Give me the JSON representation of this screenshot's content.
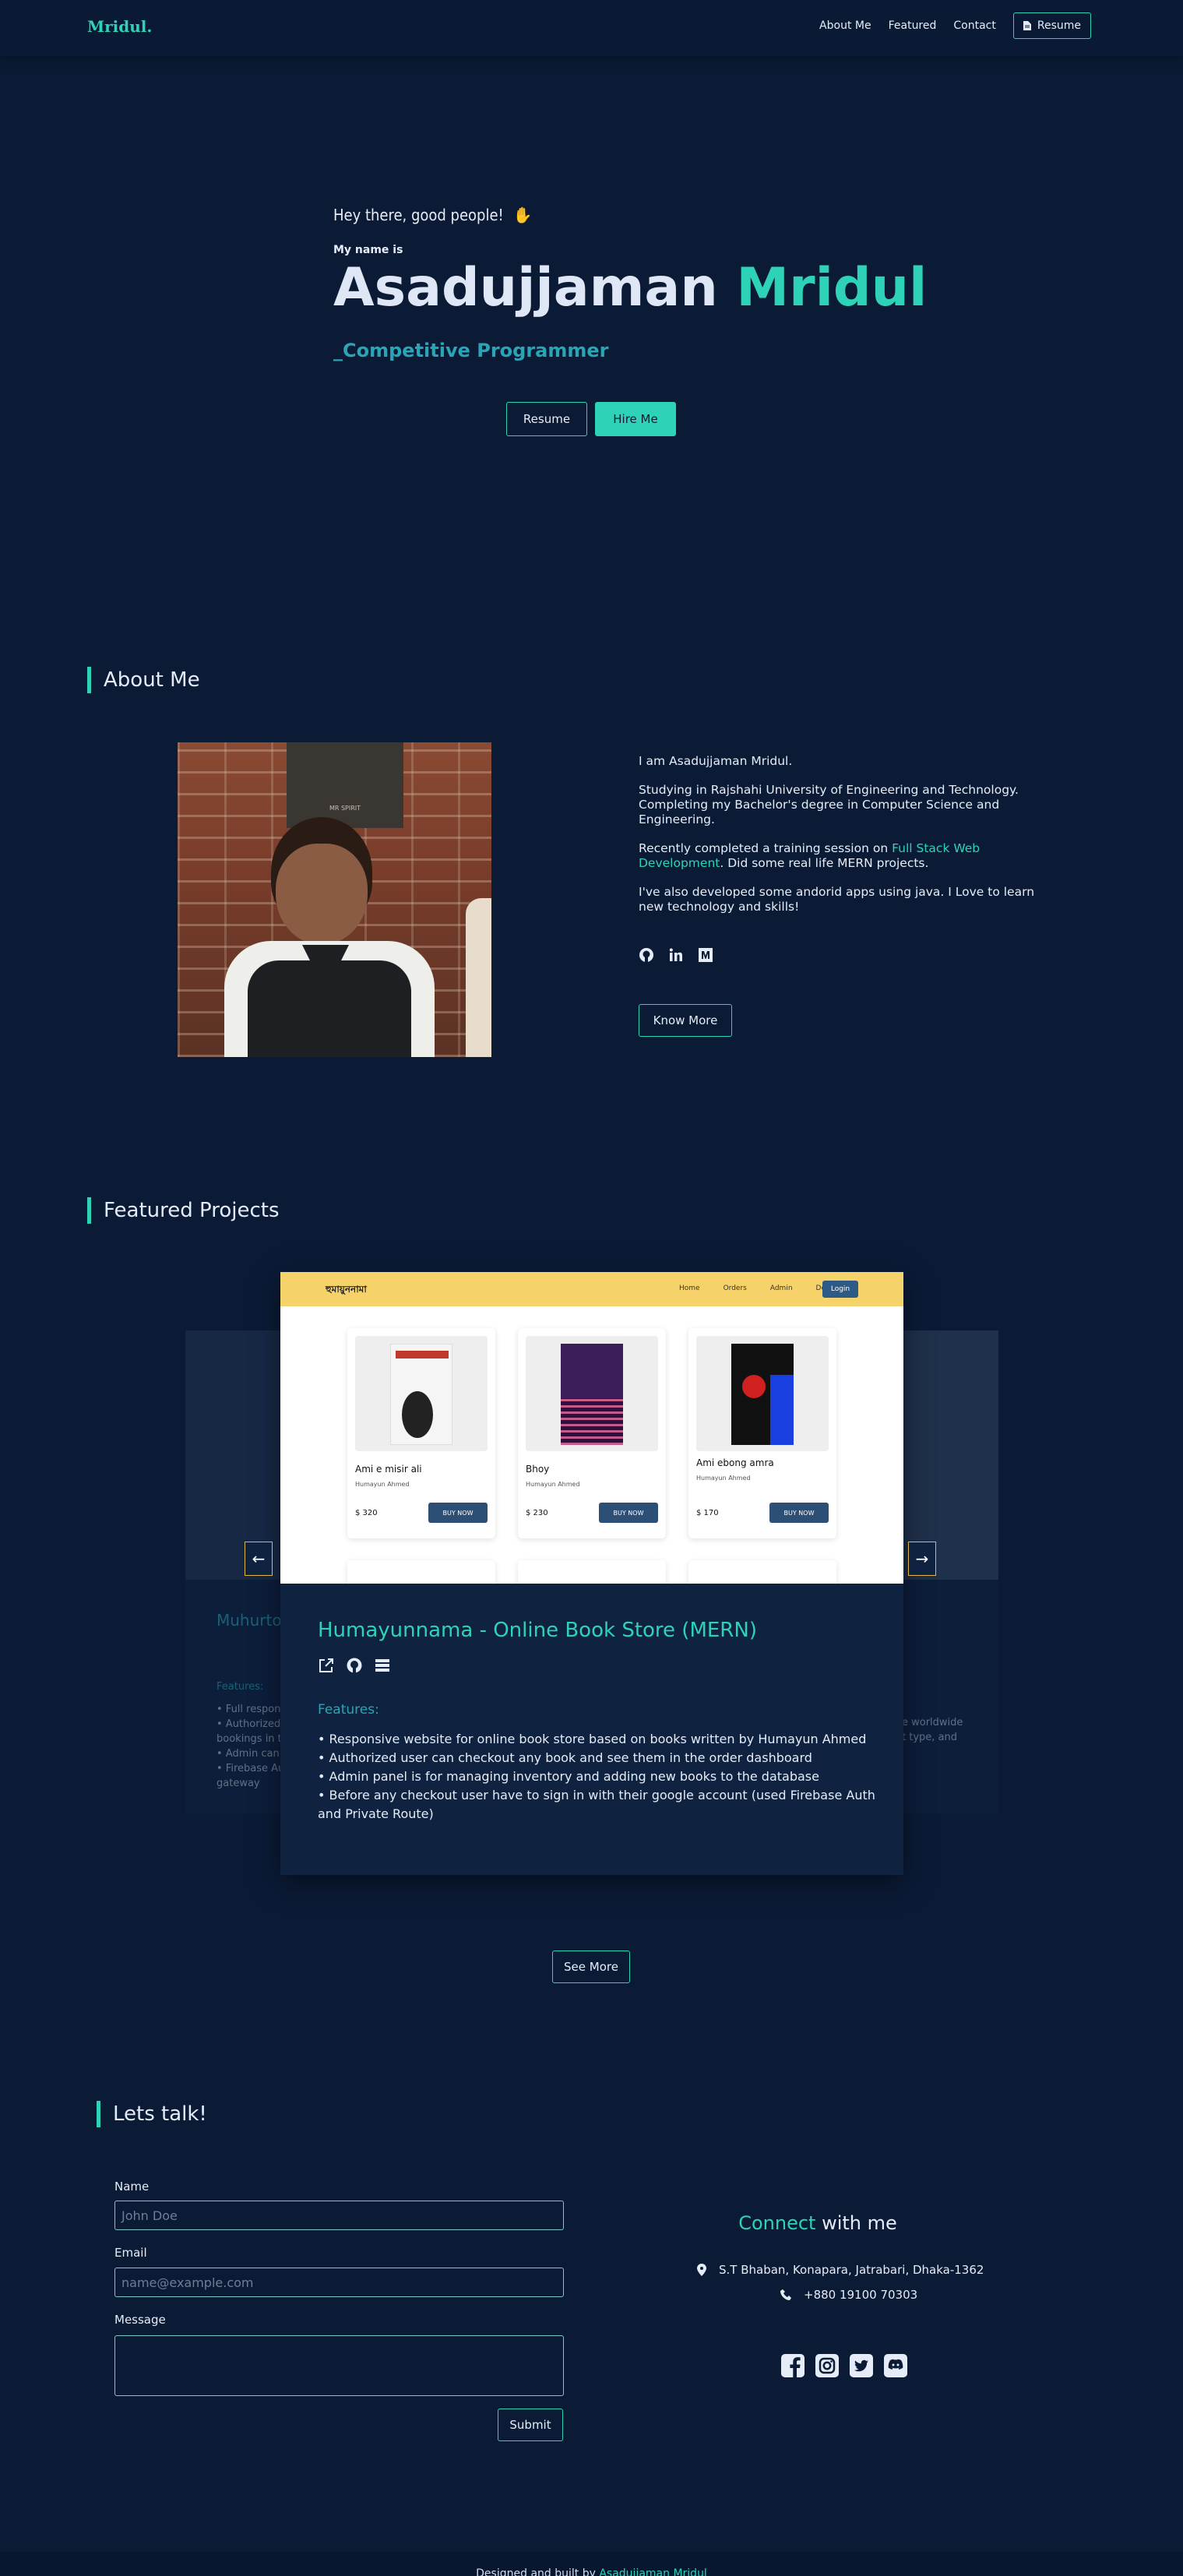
{
  "nav": {
    "logo": "Mridul.",
    "links": [
      "About Me",
      "Featured",
      "Contact"
    ],
    "resume_label": "Resume"
  },
  "hero": {
    "greeting": "Hey there, good people!",
    "greeting_emoji": "✋",
    "my_name_is": "My name is",
    "first_name": "Asadujjaman",
    "last_name": "Mridul",
    "role": "_Competitive Programmer",
    "resume_label": "Resume",
    "hire_label": "Hire Me"
  },
  "about": {
    "title": "About Me",
    "p1": "I am Asadujjaman Mridul.",
    "p2": "Studying in Rajshahi University of Engineering and Technology. Completing my Bachelor's degree in Computer Science and Engineering.",
    "p3_pre": "Recently completed a training session on ",
    "p3_link": "Full Stack Web Development",
    "p3_post": ". Did some real life MERN projects.",
    "p4": "I've also developed some andorid apps using java. I Love to learn new technology and skills!",
    "know_more_label": "Know More",
    "photo_sign": "MR SPIRIT",
    "social_icons": [
      "github-icon",
      "linkedin-icon",
      "medium-icon"
    ]
  },
  "projects": {
    "title": "Featured Projects",
    "main": {
      "title": "Humayunnama - Online Book Store (MERN)",
      "features_label": "Features:",
      "features": [
        "• Responsive website for online book store based on books written by Humayun Ahmed",
        "• Authorized user can checkout any book and see them in the order dashboard",
        "• Admin panel is for managing inventory and adding new books to the database",
        "• Before any checkout user have to sign in with their google account (used Firebase Auth and Private Route)"
      ],
      "screenshot": {
        "brand": "হুমায়ুননামা",
        "menu": [
          "Home",
          "Orders",
          "Admin",
          "Deals"
        ],
        "login": "Login",
        "books": [
          {
            "title": "Ami e misir ali",
            "author": "Humayun Ahmed",
            "price": "$ 320",
            "buy": "BUY NOW",
            "cover": "#f5f5f5"
          },
          {
            "title": "Bhoy",
            "author": "Humayun Ahmed",
            "price": "$ 230",
            "buy": "BUY NOW",
            "cover": "#3a1f5a"
          },
          {
            "title": "Ami ebong amra",
            "author": "Humayun Ahmed",
            "price": "$ 170",
            "buy": "BUY NOW",
            "cover": "#1d1d3c"
          }
        ]
      }
    },
    "left_side": {
      "title": "Muhurto",
      "features_label": "Features:",
      "features": [
        "• Full respon",
        "• Authorized",
        "bookings in t",
        "• Admin can",
        "• Firebase Au",
        "gateway"
      ]
    },
    "right_side": {
      "features": [
        "e worldwide",
        "t type, and"
      ]
    },
    "see_more_label": "See More"
  },
  "contact": {
    "title": "Lets talk!",
    "name_label": "Name",
    "name_placeholder": "John Doe",
    "email_label": "Email",
    "email_placeholder": "name@example.com",
    "message_label": "Message",
    "submit_label": "Submit",
    "connect_acc": "Connect",
    "connect_rest": " with me",
    "address": "S.T Bhaban, Konapara, Jatrabari, Dhaka-1362",
    "phone": "+880 19100 70303",
    "social_icons": [
      "facebook-icon",
      "instagram-icon",
      "twitter-icon",
      "discord-icon"
    ]
  },
  "footer": {
    "pre": "Designed and built by ",
    "name": "Asadujjaman Mridul"
  },
  "colors": {
    "background": "#0b1b36",
    "accent": "#2ed3b7",
    "secondary": "#2aa5b6",
    "screenshot_bar": "#f6d26a"
  }
}
